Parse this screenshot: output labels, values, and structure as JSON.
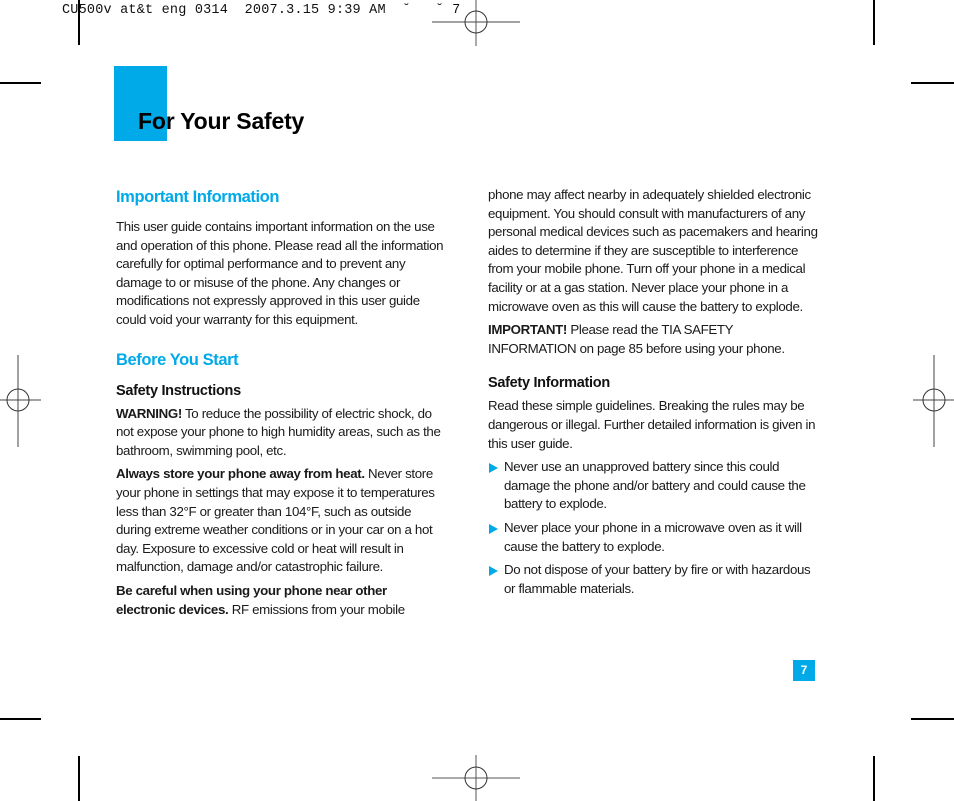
{
  "slug": {
    "text": "CU500v at&t eng 0314  2007.3.15 9:39 AM  ˘   ˘ 7"
  },
  "header": {
    "title": "For Your Safety"
  },
  "left_column": {
    "important_info": {
      "heading": "Important Information",
      "body": "This user guide contains important information on the use and operation of this phone. Please read all the information carefully for optimal performance and to prevent any damage to or misuse of the phone. Any changes or modifications not expressly approved in this user guide could void your warranty for this equipment."
    },
    "before_you_start": {
      "heading": "Before You Start",
      "subheading": "Safety Instructions",
      "warning_lead": "WARNING!",
      "warning_text": " To reduce the possibility of electric shock, do not expose your phone to high humidity areas, such as the bathroom, swimming pool, etc.",
      "heat_lead": "Always store your phone away from heat.",
      "heat_text": " Never store your phone in settings that may expose it to temperatures less than 32°F or greater than 104°F, such as outside during extreme weather conditions or in your car on a hot day. Exposure to excessive cold or heat will result in malfunction, damage and/or catastrophic failure.",
      "careful_lead": "Be careful when using your phone near other electronic devices.",
      "careful_text": " RF emissions from your mobile"
    }
  },
  "right_column": {
    "continued_text": "phone may affect nearby in adequately shielded electronic equipment. You should consult with manufacturers of any personal medical devices such as pacemakers and hearing aides to determine if they are susceptible to interference from your mobile phone. Turn off your phone in a medical facility or at a gas station. Never place your phone in a microwave oven as this will cause the battery to explode.",
    "important_lead": "IMPORTANT!",
    "important_text": " Please read the TIA SAFETY INFORMATION on page 85 before using your phone.",
    "safety_info": {
      "heading": "Safety Information",
      "intro": "Read these simple guidelines. Breaking the rules may be dangerous or illegal. Further detailed information is given in this user guide.",
      "bullets": [
        "Never use an unapproved battery since this could damage the phone and/or battery and could cause the battery to explode.",
        "Never place your phone in a microwave oven as it will cause the battery to explode.",
        "Do not dispose of your battery by fire or with hazardous or flammable materials."
      ]
    }
  },
  "footer": {
    "page_number": "7"
  },
  "colors": {
    "accent": "#00a9e8",
    "text": "#1a1a1a"
  }
}
